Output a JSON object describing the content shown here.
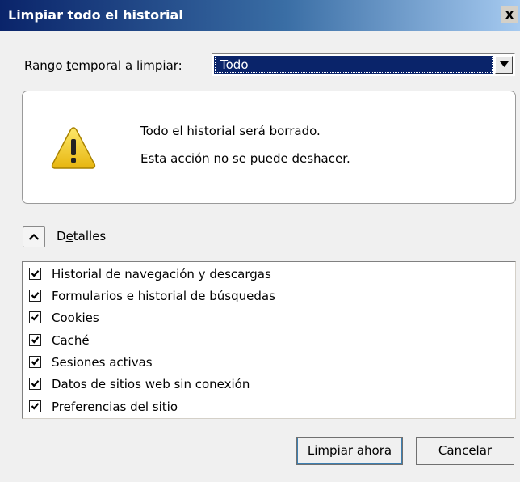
{
  "window": {
    "title": "Limpiar todo el historial",
    "close_label": "x"
  },
  "range": {
    "label_pre": "Rango ",
    "label_access": "t",
    "label_post": "emporal a limpiar:",
    "selected": "Todo"
  },
  "warning": {
    "line1": "Todo el historial será borrado.",
    "line2": "Esta acción no se puede deshacer."
  },
  "details": {
    "label_pre": "D",
    "label_access": "e",
    "label_post": "talles",
    "expanded": true
  },
  "items": [
    {
      "label": "Historial de navegación y descargas",
      "checked": true
    },
    {
      "label": "Formularios e historial de búsquedas",
      "checked": true
    },
    {
      "label": "Cookies",
      "checked": true
    },
    {
      "label": "Caché",
      "checked": true
    },
    {
      "label": "Sesiones activas",
      "checked": true
    },
    {
      "label": "Datos de sitios web sin conexión",
      "checked": true
    },
    {
      "label": "Preferencias del sitio",
      "checked": true
    }
  ],
  "buttons": {
    "clear": "Limpiar ahora",
    "cancel": "Cancelar"
  },
  "icons": {
    "warning": "warning-triangle-icon",
    "close": "close-icon",
    "dropdown": "dropdown-arrow-icon",
    "collapse": "chevron-up-icon",
    "check": "checkmark-icon"
  },
  "colors": {
    "titlebar_start": "#0a246a",
    "titlebar_end": "#a6caf0",
    "selection": "#0a246a",
    "warning_yellow": "#f5c518"
  }
}
